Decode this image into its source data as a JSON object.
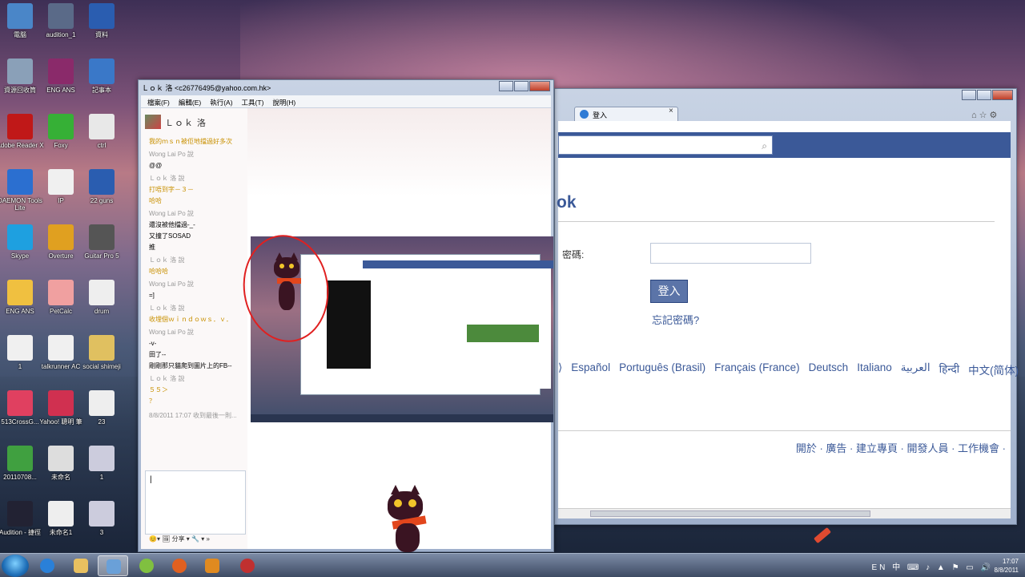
{
  "desktop": {
    "icons": [
      {
        "label": "電腦",
        "color": "#4a86c8"
      },
      {
        "label": "audition_1",
        "color": "#5a6a88"
      },
      {
        "label": "資料",
        "color": "#2a5db0"
      },
      {
        "label": "資源回收筒",
        "color": "#8aa0b8"
      },
      {
        "label": "ENG ANS",
        "color": "#8a2a6a"
      },
      {
        "label": "記事本",
        "color": "#3a78c8"
      },
      {
        "label": "Adobe Reader X",
        "color": "#c01818"
      },
      {
        "label": "Foxy",
        "color": "#36b036"
      },
      {
        "label": "ctrl",
        "color": "#e8e8e8"
      },
      {
        "label": "DAEMON Tools Lite",
        "color": "#2b6fd0"
      },
      {
        "label": "IP",
        "color": "#f0f0f0"
      },
      {
        "label": "22 guns",
        "color": "#2a5db0"
      },
      {
        "label": "Skype",
        "color": "#1ea0e0"
      },
      {
        "label": "Overture",
        "color": "#e0a020"
      },
      {
        "label": "Guitar Pro 5",
        "color": "#555"
      },
      {
        "label": "ENG ANS",
        "color": "#f0c040"
      },
      {
        "label": "PetCalc",
        "color": "#f0a0a0"
      },
      {
        "label": "drum",
        "color": "#eee"
      },
      {
        "label": "1",
        "color": "#f0f0f0"
      },
      {
        "label": "talkrunner AC",
        "color": "#f0f0f0"
      },
      {
        "label": "social shimeji",
        "color": "#e0c060"
      },
      {
        "label": "513CrossG...",
        "color": "#e04060"
      },
      {
        "label": "Yahoo! 聰明 筆",
        "color": "#d03050"
      },
      {
        "label": "23",
        "color": "#eee"
      },
      {
        "label": "20110708...",
        "color": "#40a040"
      },
      {
        "label": "未命名",
        "color": "#ddd"
      },
      {
        "label": "1",
        "color": "#ccd"
      },
      {
        "label": "Audition - 捷徑",
        "color": "#223"
      },
      {
        "label": "未命名1",
        "color": "#eee"
      },
      {
        "label": "3",
        "color": "#ccd"
      }
    ]
  },
  "browser": {
    "tab_title": "登入",
    "search_icon": "search-icon",
    "logo_fragment": "ok",
    "password_label": "密碼:",
    "login_button": "登入",
    "forgot_password": "忘記密碼?",
    "languages": [
      "⟩",
      "Español",
      "Português (Brasil)",
      "Français (France)",
      "Deutsch",
      "Italiano",
      "العربية",
      "हिन्दी",
      "中文(简体)"
    ],
    "footer": "開於 · 廣告 · 建立專頁 · 開發人員 · 工作機會 ·"
  },
  "msn": {
    "title": "Ｌｏｋ 洛 <c26776495@yahoo.com.hk>",
    "menu": [
      "檔案(F)",
      "編輯(E)",
      "執行(A)",
      "工具(T)",
      "說明(H)"
    ],
    "contact_name": "Ｌｏｋ 洛",
    "messages": [
      {
        "type": "me",
        "text": "我的ｍｓｎ被佢地擋過好多次"
      },
      {
        "type": "who",
        "text": "Wong Lai Po 說"
      },
      {
        "type": "msg",
        "text": "@@"
      },
      {
        "type": "who",
        "text": "Ｌｏｋ 洛 說"
      },
      {
        "type": "me",
        "text": "打唔到字－３－"
      },
      {
        "type": "me",
        "text": "哈哈"
      },
      {
        "type": "who",
        "text": "Wong Lai Po 說"
      },
      {
        "type": "msg",
        "text": "還沒被他擋過-_-"
      },
      {
        "type": "msg",
        "text": "又撞了SOSAD"
      },
      {
        "type": "msg",
        "text": "推"
      },
      {
        "type": "who",
        "text": "Ｌｏｋ 洛 說"
      },
      {
        "type": "me",
        "text": "哈哈哈"
      },
      {
        "type": "who",
        "text": "Wong Lai Po 說"
      },
      {
        "type": "msg",
        "text": "=]"
      },
      {
        "type": "who",
        "text": "Ｌｏｋ 洛 說"
      },
      {
        "type": "me",
        "text": "收埋個ｗｉｎｄｏｗｓ．ｖ．"
      },
      {
        "type": "who",
        "text": "Wong Lai Po 說"
      },
      {
        "type": "msg",
        "text": "-v-"
      },
      {
        "type": "msg",
        "text": "田了--"
      },
      {
        "type": "msg",
        "text": "剛剛那只貓爬到圖片上的FB--"
      },
      {
        "type": "who",
        "text": "Ｌｏｋ 洛 說"
      },
      {
        "type": "me",
        "text": "５５＞"
      },
      {
        "type": "me",
        "text": "？"
      },
      {
        "type": "sys",
        "text": "8/8/2011 17:07 收到最後一則..."
      }
    ],
    "input_value": "|",
    "tools": "😊▾  🖼 分享 ▾  🔧 ▾      »"
  },
  "taskbar": {
    "tray_text": "EN 中 ⌨ ♪ ▲ ⚑ ▭ 🔊",
    "time": "17:07",
    "date": "8/8/2011"
  }
}
